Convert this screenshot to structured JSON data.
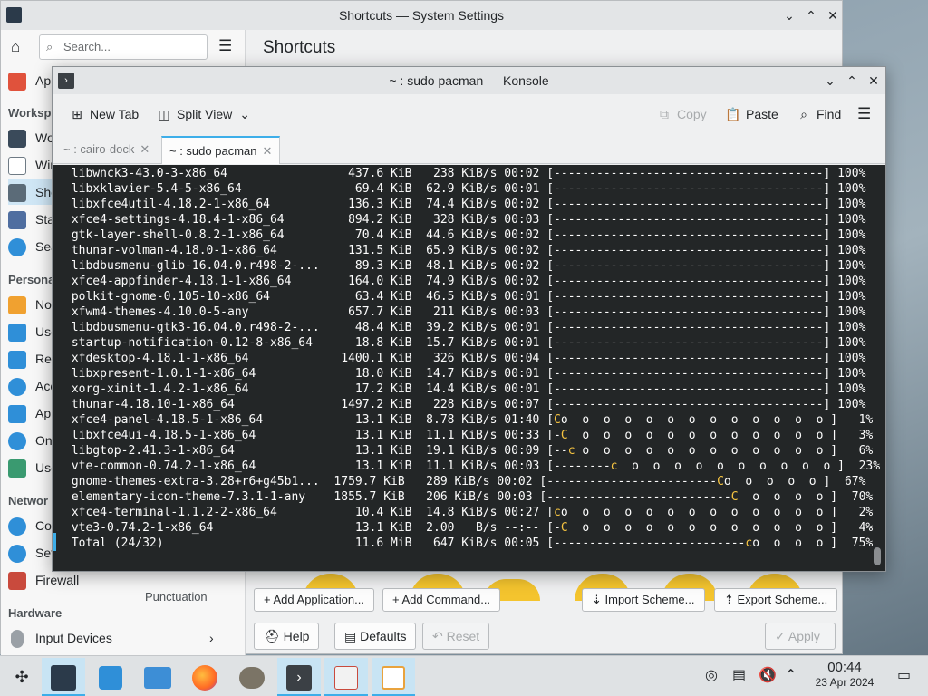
{
  "settings": {
    "title": "Shortcuts — System Settings",
    "search_placeholder": "Search...",
    "page_title": "Shortcuts",
    "sidebar_items": [
      {
        "label": "App",
        "color": "#e0523c"
      },
      {
        "label": "Wo",
        "color": "#3a4a5a"
      },
      {
        "label": "Wir",
        "color": "#6e7a84"
      },
      {
        "label": "Sho",
        "color": "#5b6b78"
      },
      {
        "label": "Sta",
        "color": "#4f6ea0"
      },
      {
        "label": "Sea",
        "color": "#2f8fd8"
      },
      {
        "label": "Not",
        "color": "#f0a130"
      },
      {
        "label": "Use",
        "color": "#2f8fd8"
      },
      {
        "label": "Reg",
        "color": "#2f8fd8"
      },
      {
        "label": "Acc",
        "color": "#2f8fd8"
      },
      {
        "label": "App",
        "color": "#2f8fd8"
      },
      {
        "label": "Onl",
        "color": "#2f8fd8"
      },
      {
        "label": "Use",
        "color": "#3a9a70"
      },
      {
        "label": "Con",
        "color": "#2f8fd8"
      },
      {
        "label": "Set",
        "color": "#2f8fd8"
      },
      {
        "label": "Firewall",
        "color": "#c94a3d"
      },
      {
        "label": "Input Devices",
        "color": "#9aa0a6"
      }
    ],
    "section_workspace": "Worksp",
    "section_personal": "Persona",
    "section_network": "Networ",
    "section_hardware": "Hardware",
    "behind_item": "Punctuation",
    "bottom_buttons": {
      "add_application": "Add Application...",
      "add_command": "Add Command...",
      "import_scheme": "Import Scheme...",
      "export_scheme": "Export Scheme...",
      "help": "Help",
      "defaults": "Defaults",
      "reset": "Reset",
      "apply": "Apply"
    }
  },
  "konsole": {
    "title": "~ : sudo pacman — Konsole",
    "toolbar": {
      "new_tab": "New Tab",
      "split_view": "Split View",
      "copy": "Copy",
      "paste": "Paste",
      "find": "Find"
    },
    "tabs": [
      {
        "label": "~ : cairo-dock"
      },
      {
        "label": "~ : sudo pacman"
      }
    ],
    "terminal_lines": [
      {
        "text": " libwnck3-43.0-3-x86_64                 437.6 KiB   238 KiB/s 00:02 [--------------------------------------] 100%"
      },
      {
        "text": " libxklavier-5.4-5-x86_64                69.4 KiB  62.9 KiB/s 00:01 [--------------------------------------] 100%"
      },
      {
        "text": " libxfce4util-4.18.2-1-x86_64           136.3 KiB  74.4 KiB/s 00:02 [--------------------------------------] 100%"
      },
      {
        "text": " xfce4-settings-4.18.4-1-x86_64         894.2 KiB   328 KiB/s 00:03 [--------------------------------------] 100%"
      },
      {
        "text": " gtk-layer-shell-0.8.2-1-x86_64          70.4 KiB  44.6 KiB/s 00:02 [--------------------------------------] 100%"
      },
      {
        "text": " thunar-volman-4.18.0-1-x86_64          131.5 KiB  65.9 KiB/s 00:02 [--------------------------------------] 100%"
      },
      {
        "text": " libdbusmenu-glib-16.04.0.r498-2-...     89.3 KiB  48.1 KiB/s 00:02 [--------------------------------------] 100%"
      },
      {
        "text": " xfce4-appfinder-4.18.1-1-x86_64        164.0 KiB  74.9 KiB/s 00:02 [--------------------------------------] 100%"
      },
      {
        "text": " polkit-gnome-0.105-10-x86_64            63.4 KiB  46.5 KiB/s 00:01 [--------------------------------------] 100%"
      },
      {
        "text": " xfwm4-themes-4.10.0-5-any              657.7 KiB   211 KiB/s 00:03 [--------------------------------------] 100%"
      },
      {
        "text": " libdbusmenu-gtk3-16.04.0.r498-2-...     48.4 KiB  39.2 KiB/s 00:01 [--------------------------------------] 100%"
      },
      {
        "text": " startup-notification-0.12-8-x86_64      18.8 KiB  15.7 KiB/s 00:01 [--------------------------------------] 100%"
      },
      {
        "text": " xfdesktop-4.18.1-1-x86_64             1400.1 KiB   326 KiB/s 00:04 [--------------------------------------] 100%"
      },
      {
        "text": " libxpresent-1.0.1-1-x86_64              18.0 KiB  14.7 KiB/s 00:01 [--------------------------------------] 100%"
      },
      {
        "text": " xorg-xinit-1.4.2-1-x86_64               17.2 KiB  14.4 KiB/s 00:01 [--------------------------------------] 100%"
      },
      {
        "text": " thunar-4.18.10-1-x86_64               1497.2 KiB   228 KiB/s 00:07 [--------------------------------------] 100%"
      },
      {
        "text": " xfce4-panel-4.18.5-1-x86_64             13.1 KiB  8.78 KiB/s 01:40 [Co  o  o  o  o  o  o  o  o  o  o  o  o ]   1%"
      },
      {
        "text": " libxfce4ui-4.18.5-1-x86_64              13.1 KiB  11.1 KiB/s 00:33 [-C  o  o  o  o  o  o  o  o  o  o  o  o ]   3%"
      },
      {
        "text": " libgtop-2.41.3-1-x86_64                 13.1 KiB  19.1 KiB/s 00:09 [--c o  o  o  o  o  o  o  o  o  o  o  o ]   6%"
      },
      {
        "text": " vte-common-0.74.2-1-x86_64              13.1 KiB  11.1 KiB/s 00:03 [--------c  o  o  o  o  o  o  o  o  o  o ]  23%"
      },
      {
        "text": " gnome-themes-extra-3.28+r6+g45b1...  1759.7 KiB   289 KiB/s 00:02 [------------------------Co  o  o  o  o ]  67%"
      },
      {
        "text": " elementary-icon-theme-7.3.1-1-any    1855.7 KiB   206 KiB/s 00:03 [--------------------------C  o  o  o  o ]  70%"
      },
      {
        "text": " xfce4-terminal-1.1.2-2-x86_64           10.4 KiB  14.8 KiB/s 00:27 [co  o  o  o  o  o  o  o  o  o  o  o  o ]   2%"
      },
      {
        "text": " vte3-0.74.2-1-x86_64                    13.1 KiB  2.00   B/s --:-- [-C  o  o  o  o  o  o  o  o  o  o  o  o ]   4%"
      },
      {
        "text": " Total (24/32)                           11.6 MiB   647 KiB/s 00:05 [---------------------------co  o  o  o ]  75%"
      }
    ]
  },
  "panel": {
    "time": "00:44",
    "date": "23 Apr 2024"
  }
}
